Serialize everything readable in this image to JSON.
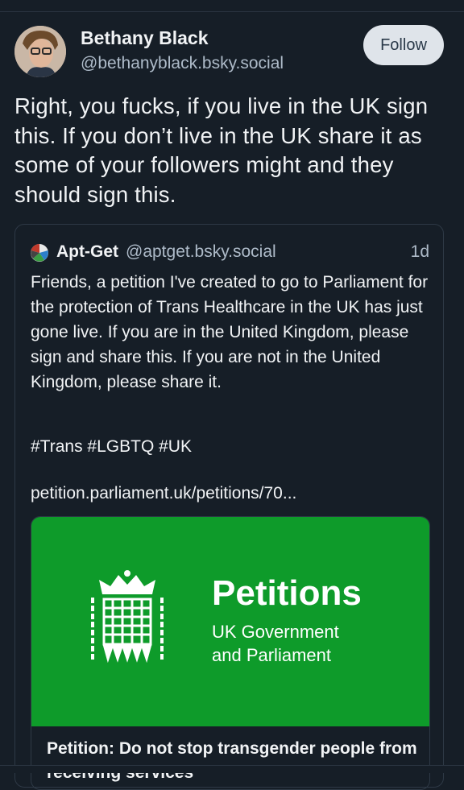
{
  "post": {
    "author_name": "Bethany Black",
    "author_handle": "@bethanyblack.bsky.social",
    "follow_label": "Follow",
    "text": "Right, you fucks, if you live in the UK sign this. If you don’t live in the UK share it as some of your followers might and they should sign this."
  },
  "quote": {
    "author_name": "Apt-Get",
    "author_handle": "@aptget.bsky.social",
    "time": "1d",
    "text": "Friends, a petition I've created to go to Parliament for the protection of Trans Healthcare in the UK has just gone live. If you are in the United Kingdom, please sign and share this. If you are not in the United Kingdom, please share it.",
    "tags": "#Trans #LGBTQ #UK",
    "link": "petition.parliament.uk/petitions/70..."
  },
  "link_card": {
    "thumb_title": "Petitions",
    "thumb_subtitle_1": "UK Government",
    "thumb_subtitle_2": "and Parliament",
    "title": "Petition: Do not stop transgender people from receiving services"
  },
  "colors": {
    "background": "#161e27",
    "petitions_green": "#0e9b2a",
    "follow_button_bg": "#dfe4ea"
  },
  "icons": {
    "avatar": "user-avatar",
    "quote_avatar": "apt-get-logo-icon",
    "portcullis": "portcullis-icon"
  }
}
